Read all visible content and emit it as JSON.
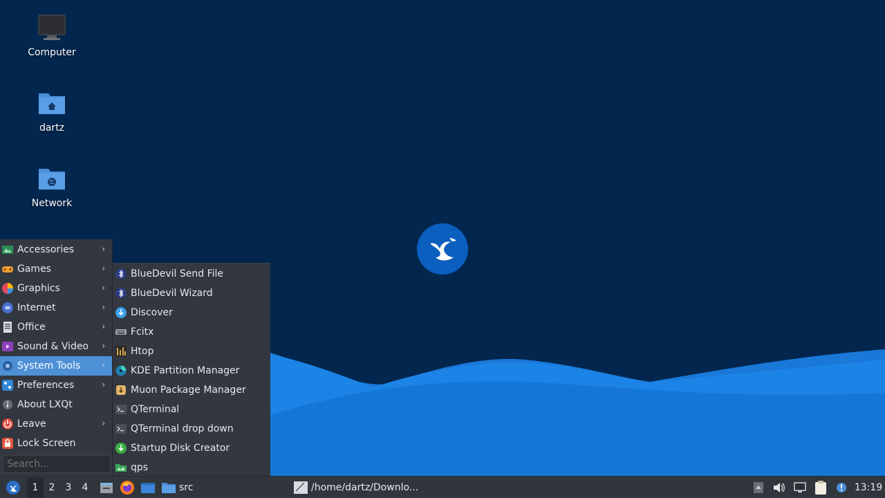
{
  "desktop": {
    "icons": [
      {
        "label": "Computer",
        "icon": "computer-icon"
      },
      {
        "label": "dartz",
        "icon": "home-folder-icon"
      },
      {
        "label": "Network",
        "icon": "network-folder-icon"
      }
    ],
    "wallpaper_logo": "lubuntu-bird-logo"
  },
  "main_menu": {
    "items": [
      {
        "label": "Accessories",
        "icon": "accessories-icon",
        "submenu": true
      },
      {
        "label": "Games",
        "icon": "games-icon",
        "submenu": true
      },
      {
        "label": "Graphics",
        "icon": "graphics-icon",
        "submenu": true
      },
      {
        "label": "Internet",
        "icon": "internet-icon",
        "submenu": true
      },
      {
        "label": "Office",
        "icon": "office-icon",
        "submenu": true
      },
      {
        "label": "Sound & Video",
        "icon": "sound-video-icon",
        "submenu": true
      },
      {
        "label": "System Tools",
        "icon": "system-tools-icon",
        "submenu": true,
        "active": true
      },
      {
        "label": "Preferences",
        "icon": "preferences-icon",
        "submenu": true
      },
      {
        "label": "About LXQt",
        "icon": "info-icon",
        "submenu": false
      },
      {
        "label": "Leave",
        "icon": "power-icon",
        "submenu": true
      },
      {
        "label": "Lock Screen",
        "icon": "lock-icon",
        "submenu": false
      }
    ],
    "search_placeholder": "Search..."
  },
  "system_tools_menu": {
    "items": [
      {
        "label": "BlueDevil Send File",
        "icon": "bluetooth-icon"
      },
      {
        "label": "BlueDevil Wizard",
        "icon": "bluetooth-icon"
      },
      {
        "label": "Discover",
        "icon": "discover-icon"
      },
      {
        "label": "Fcitx",
        "icon": "keyboard-icon"
      },
      {
        "label": "Htop",
        "icon": "htop-icon"
      },
      {
        "label": "KDE Partition Manager",
        "icon": "partition-manager-icon"
      },
      {
        "label": "Muon Package Manager",
        "icon": "package-manager-icon"
      },
      {
        "label": "QTerminal",
        "icon": "terminal-icon"
      },
      {
        "label": "QTerminal drop down",
        "icon": "terminal-icon"
      },
      {
        "label": "Startup Disk Creator",
        "icon": "startup-disk-icon"
      },
      {
        "label": "qps",
        "icon": "qps-icon"
      }
    ]
  },
  "taskbar": {
    "workspaces": [
      "1",
      "2",
      "3",
      "4"
    ],
    "active_workspace": "1",
    "quicklaunch": [
      "show-desktop-icon",
      "firefox-icon",
      "file-manager-icon"
    ],
    "folder_label": "src",
    "task_title": "/home/dartz/Downlo...",
    "tray": [
      "tray-arrow-icon",
      "volume-icon",
      "network-icon",
      "clipboard-icon",
      "notification-icon"
    ],
    "clock": "13:19"
  },
  "colors": {
    "desktop_bg": "#02264e",
    "menu_bg": "#33373f",
    "menu_highlight": "#4d90d6",
    "taskbar_bg": "#31353c"
  }
}
